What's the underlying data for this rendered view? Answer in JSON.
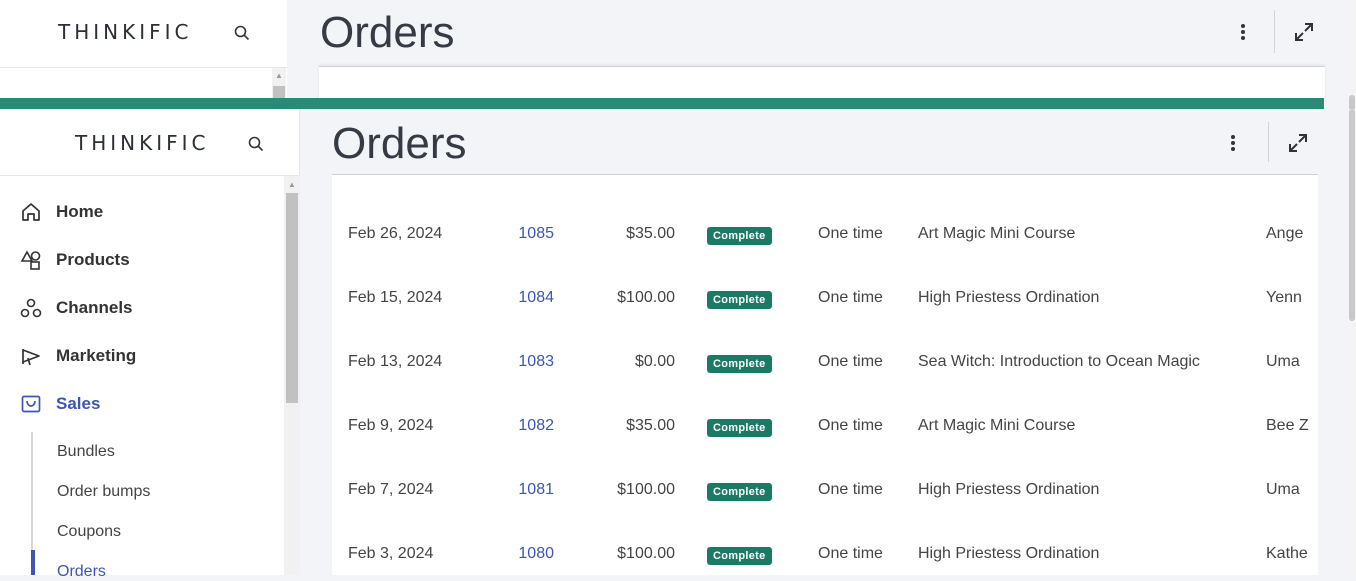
{
  "brand": {
    "logo_text": "THINKIFIC"
  },
  "header": {
    "title": "Orders",
    "menu_icon": "kebab-menu-icon",
    "expand_icon": "expand-icon"
  },
  "sidebar": {
    "items": [
      {
        "label": "Home",
        "icon": "home-icon"
      },
      {
        "label": "Products",
        "icon": "products-icon"
      },
      {
        "label": "Channels",
        "icon": "channels-icon"
      },
      {
        "label": "Marketing",
        "icon": "megaphone-icon"
      },
      {
        "label": "Sales",
        "icon": "sales-icon",
        "active": true
      }
    ],
    "sub_items": [
      {
        "label": "Bundles"
      },
      {
        "label": "Order bumps"
      },
      {
        "label": "Coupons"
      },
      {
        "label": "Orders",
        "active": true
      }
    ]
  },
  "orders": {
    "rows": [
      {
        "date": "Feb 26, 2024",
        "id": "1085",
        "amount": "$35.00",
        "status": "Complete",
        "type": "One time",
        "product": "Art Magic Mini Course",
        "customer": "Ange"
      },
      {
        "date": "Feb 15, 2024",
        "id": "1084",
        "amount": "$100.00",
        "status": "Complete",
        "type": "One time",
        "product": "High Priestess Ordination",
        "customer": "Yenn"
      },
      {
        "date": "Feb 13, 2024",
        "id": "1083",
        "amount": "$0.00",
        "status": "Complete",
        "type": "One time",
        "product": "Sea Witch: Introduction to Ocean Magic",
        "customer": "Uma"
      },
      {
        "date": "Feb 9, 2024",
        "id": "1082",
        "amount": "$35.00",
        "status": "Complete",
        "type": "One time",
        "product": "Art Magic Mini Course",
        "customer": "Bee Z"
      },
      {
        "date": "Feb 7, 2024",
        "id": "1081",
        "amount": "$100.00",
        "status": "Complete",
        "type": "One time",
        "product": "High Priestess Ordination",
        "customer": "Uma"
      },
      {
        "date": "Feb 3, 2024",
        "id": "1080",
        "amount": "$100.00",
        "status": "Complete",
        "type": "One time",
        "product": "High Priestess Ordination",
        "customer": "Kathe"
      }
    ]
  },
  "colors": {
    "accent": "#3d55b3",
    "status_green": "#1a7a64",
    "teal_bar": "#2a8a76"
  }
}
